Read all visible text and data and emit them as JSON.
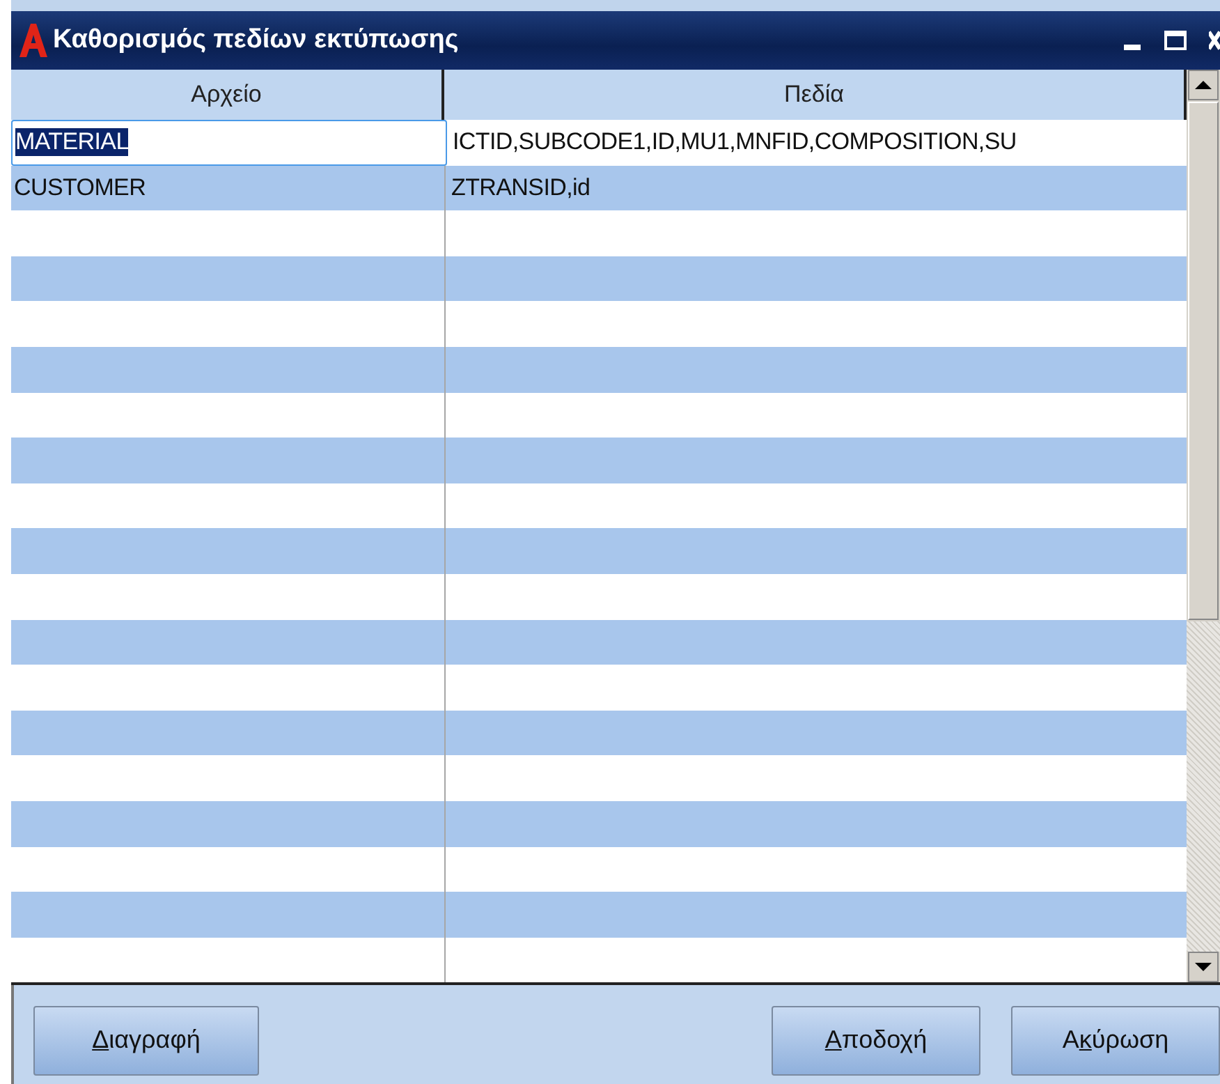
{
  "window": {
    "title": "Καθορισμός πεδίων εκτύπωσης"
  },
  "table": {
    "columns": [
      "Αρχείο",
      "Πεδία"
    ],
    "rows": [
      {
        "cells": [
          "MATERIAL",
          "ICTID,SUBCODE1,ID,MU1,MNFID,COMPOSITION,SU"
        ],
        "selected": true
      },
      {
        "cells": [
          "CUSTOMER",
          "ZTRANSID,id"
        ],
        "selected": false
      }
    ]
  },
  "left_buttons": [
    {
      "key": "Δ",
      "after": "ιαγραφή"
    }
  ],
  "right_buttons": [
    {
      "key": "Α",
      "after": "ποδοχή"
    },
    {
      "before": "Α",
      "key": "κ",
      "after": "ύρωση"
    }
  ]
}
